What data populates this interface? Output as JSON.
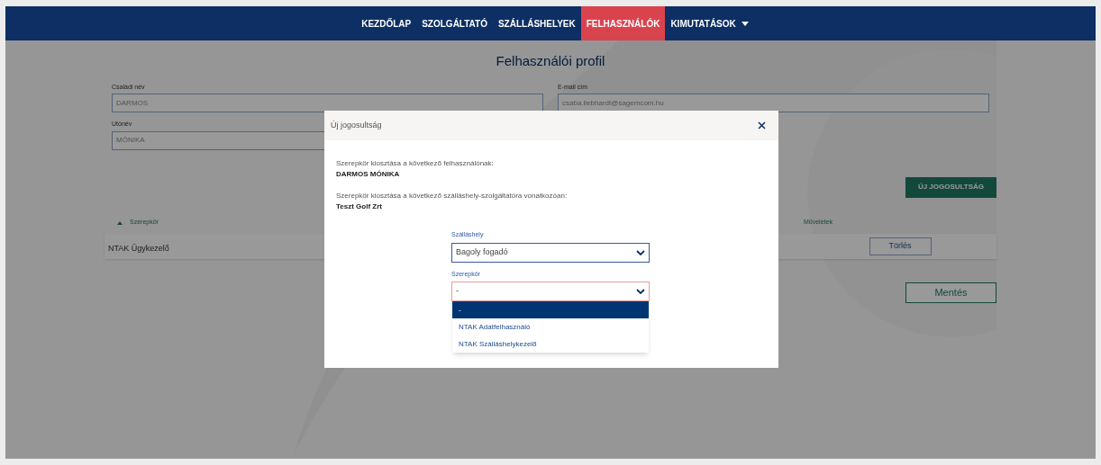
{
  "nav": [
    {
      "label": "KEZDŐLAP",
      "selected": false,
      "dropdown": false
    },
    {
      "label": "SZOLGÁLTATÓ",
      "selected": false,
      "dropdown": false
    },
    {
      "label": "SZÁLLÁSHELYEK",
      "selected": false,
      "dropdown": false
    },
    {
      "label": "FELHASZNÁLÓK",
      "selected": true,
      "dropdown": false
    },
    {
      "label": "KIMUTATÁSOK",
      "selected": false,
      "dropdown": true
    }
  ],
  "page": {
    "title": "Felhasználói profil",
    "fields": [
      {
        "label": "Családi név",
        "value": "DARMOS"
      },
      {
        "label": "E-mail cím",
        "value": "csaba.liebhardt@sagemcom.hu"
      },
      {
        "label": "Utónév",
        "value": "MÓNIKA"
      }
    ],
    "new_button": "ÚJ JOGOSULTSÁG",
    "columns": [
      {
        "label": "Szerepkör",
        "sorted": true
      },
      {
        "label": "Műveletek",
        "sorted": false
      }
    ],
    "rows": [
      {
        "role": "NTAK Ügykezelő",
        "action": "Törlés"
      }
    ],
    "save_button": "Mentés"
  },
  "modal": {
    "title": "Új jogosultság",
    "info": [
      {
        "text": "Szerepkör kiosztása a következő felhasználónak:",
        "value": "DARMOS MÓNIKA"
      },
      {
        "text": "Szerepkör kiosztása a következő szálláshely-szolgáltatóra vonatkozóan:",
        "value": "Teszt Golf Zrt"
      }
    ],
    "selects": [
      {
        "label": "Szálláshely",
        "value": "Bagoly fogadó",
        "invalid": false
      },
      {
        "label": "Szerepkör",
        "value": "-",
        "invalid": true,
        "options": [
          {
            "label": "-",
            "selected": true
          },
          {
            "label": "NTAK Adatfelhasználó",
            "selected": false
          },
          {
            "label": "NTAK Szálláshelykezelő",
            "selected": false
          }
        ]
      }
    ]
  }
}
